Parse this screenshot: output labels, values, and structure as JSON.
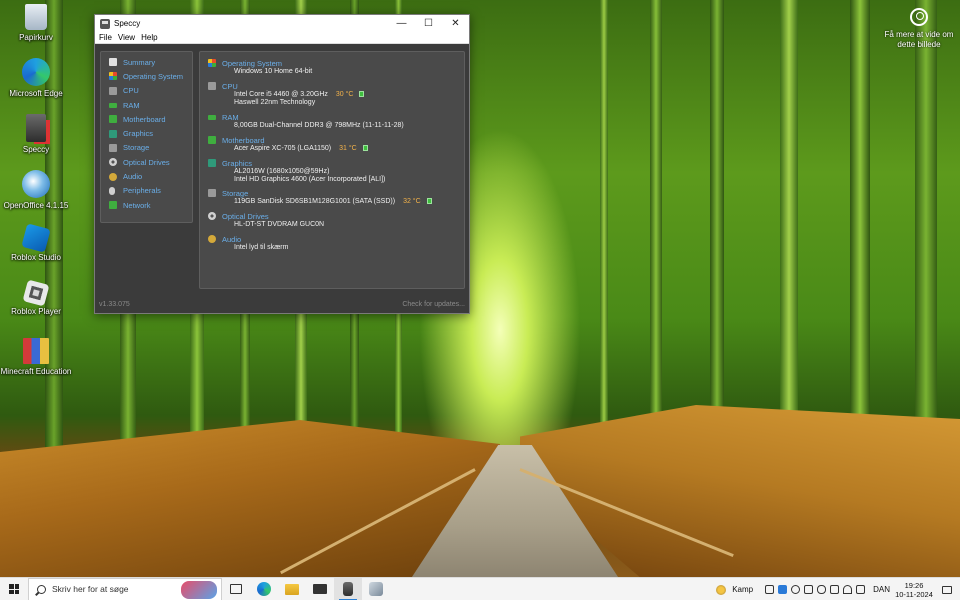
{
  "desktop": {
    "icons": [
      {
        "label": "Papirkurv",
        "icon": "recycle-bin-icon"
      },
      {
        "label": "Microsoft Edge",
        "icon": "edge-icon"
      },
      {
        "label": "Speccy",
        "icon": "speccy-icon"
      },
      {
        "label": "OpenOffice 4.1.15",
        "icon": "openoffice-icon"
      },
      {
        "label": "Roblox Studio",
        "icon": "roblox-studio-icon"
      },
      {
        "label": "Roblox Player",
        "icon": "roblox-player-icon"
      },
      {
        "label": "Minecraft Education",
        "icon": "minecraft-education-icon"
      }
    ],
    "corner_info": {
      "line1": "Få mere at vide om",
      "line2": "dette billede",
      "icon": "info-circle-icon"
    }
  },
  "window": {
    "title": "Speccy",
    "controls": {
      "minimize": "—",
      "maximize": "☐",
      "close": "✕"
    },
    "menu": [
      "File",
      "View",
      "Help"
    ],
    "sidebar": [
      {
        "label": "Summary",
        "color": "#e0e0e0"
      },
      {
        "label": "Operating System",
        "color": "#3a8fd9"
      },
      {
        "label": "CPU",
        "color": "#9a9a9a"
      },
      {
        "label": "RAM",
        "color": "#3fae3f"
      },
      {
        "label": "Motherboard",
        "color": "#3fae3f"
      },
      {
        "label": "Graphics",
        "color": "#2f9a7a"
      },
      {
        "label": "Storage",
        "color": "#9a9a9a"
      },
      {
        "label": "Optical Drives",
        "color": "#d0d0d0"
      },
      {
        "label": "Audio",
        "color": "#d4a93a"
      },
      {
        "label": "Peripherals",
        "color": "#d0d0d0"
      },
      {
        "label": "Network",
        "color": "#3fae3f"
      }
    ],
    "summary": {
      "os": {
        "title": "Operating System",
        "lines": [
          "Windows 10 Home 64-bit"
        ]
      },
      "cpu": {
        "title": "CPU",
        "line1": "Intel Core i5 4460 @ 3.20GHz",
        "temp": "30 °C",
        "line2": "Haswell 22nm Technology"
      },
      "ram": {
        "title": "RAM",
        "line1": "8,00GB Dual-Channel DDR3 @ 798MHz (11-11-11-28)"
      },
      "motherboard": {
        "title": "Motherboard",
        "line1": "Acer Aspire XC-705 (LGA1150)",
        "temp": "31 °C"
      },
      "graphics": {
        "title": "Graphics",
        "line1": "AL2016W (1680x1050@59Hz)",
        "line2": "Intel HD Graphics 4600 (Acer Incorporated [ALI])"
      },
      "storage": {
        "title": "Storage",
        "line1": "119GB SanDisk SD6SB1M128G1001 (SATA (SSD))",
        "temp": "32 °C"
      },
      "optical": {
        "title": "Optical Drives",
        "line1": "HL-DT-ST DVDRAM GUC0N"
      },
      "audio": {
        "title": "Audio",
        "line1": "Intel lyd til skærm"
      }
    },
    "status": {
      "version": "v1.33.075",
      "update": "Check for updates..."
    }
  },
  "taskbar": {
    "search_placeholder": "Skriv her for at søge",
    "weather": "Kamp",
    "language": "DAN",
    "time": "19:26",
    "date": "10-11-2024"
  }
}
